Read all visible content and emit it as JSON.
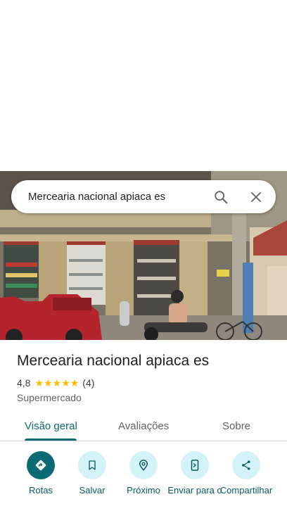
{
  "search": {
    "query": "Mercearia nacional apiaca es"
  },
  "place": {
    "name": "Mercearia nacional apiaca es",
    "rating": "4,8",
    "stars": [
      "★",
      "★",
      "★",
      "★",
      "★"
    ],
    "review_count": "(4)",
    "category": "Supermercado"
  },
  "tabs": [
    {
      "label": "Visão geral",
      "active": true
    },
    {
      "label": "Avaliações",
      "active": false
    },
    {
      "label": "Sobre",
      "active": false
    }
  ],
  "actions": [
    {
      "label": "Rotas",
      "icon": "directions-icon"
    },
    {
      "label": "Salvar",
      "icon": "bookmark-icon"
    },
    {
      "label": "Próximo",
      "icon": "nearby-icon"
    },
    {
      "label": "Enviar para o",
      "icon": "send-to-phone-icon"
    },
    {
      "label": "Compartilhar",
      "icon": "share-icon"
    }
  ],
  "colors": {
    "accent": "#0b6a73",
    "action_bg": "#d4f3f8",
    "star": "#fbbc04"
  }
}
